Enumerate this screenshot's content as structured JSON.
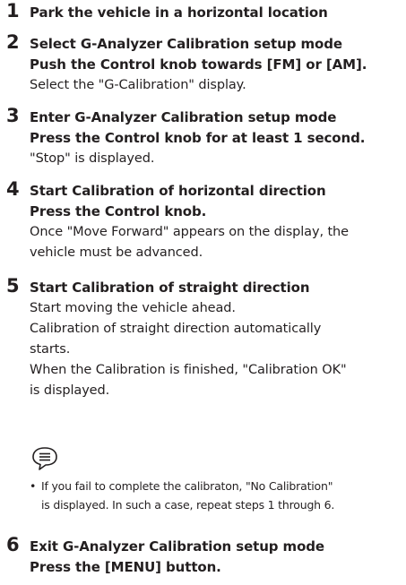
{
  "steps": [
    {
      "number": "1",
      "title": "Park the vehicle in a horizontal location"
    },
    {
      "number": "2",
      "title": "Select G-Analyzer Calibration setup mode",
      "action": "Push the Control knob towards [FM] or [AM].",
      "description": "Select the \"G-Calibration\" display."
    },
    {
      "number": "3",
      "title": "Enter G-Analyzer Calibration setup mode",
      "action": "Press the Control knob for at least 1 second.",
      "description": "\"Stop\" is displayed."
    },
    {
      "number": "4",
      "title": "Start Calibration of horizontal direction",
      "action": "Press the Control knob.",
      "description_lines": [
        "Once \"Move Forward\" appears on the display, the",
        "vehicle must be advanced."
      ]
    },
    {
      "number": "5",
      "title": "Start Calibration of straight direction",
      "description_lines": [
        "Start moving the vehicle ahead.",
        "Calibration of straight direction automatically",
        "starts.",
        "When the Calibration is finished, \"Calibration OK\"",
        "is displayed."
      ]
    },
    {
      "number": "6",
      "title": "Exit G-Analyzer Calibration setup mode",
      "action": "Press the [MENU] button."
    }
  ],
  "note": {
    "icon": "note-icon",
    "bullet": "•",
    "lines": [
      "If you fail to complete the calibraton, \"No Calibration\"",
      "is displayed. In such a case, repeat steps 1 through 6."
    ]
  }
}
